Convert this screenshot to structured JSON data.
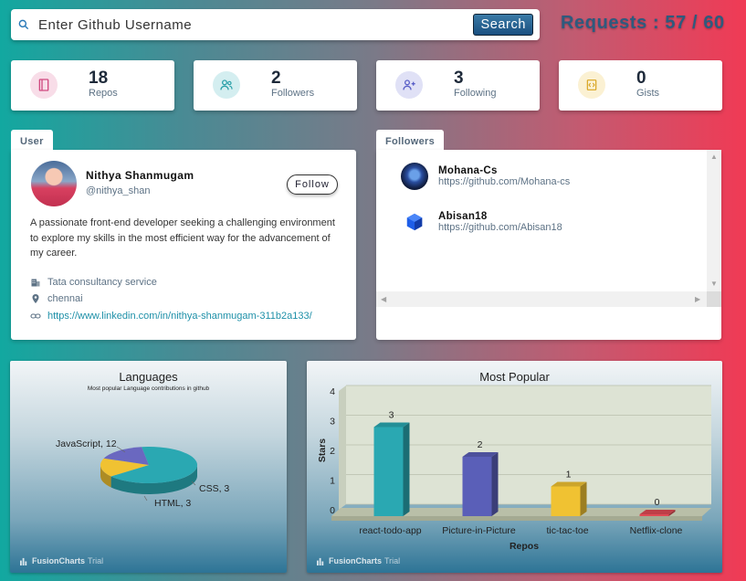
{
  "search": {
    "placeholder": "Enter Github Username",
    "button_label": "Search"
  },
  "requests_text": "Requests : 57 / 60",
  "stats": [
    {
      "value": "18",
      "label": "Repos",
      "icon": "book-icon",
      "color": "#d04a80",
      "bg": "#f8dde8"
    },
    {
      "value": "2",
      "label": "Followers",
      "icon": "users-icon",
      "color": "#2aa0a8",
      "bg": "#d4eef0"
    },
    {
      "value": "3",
      "label": "Following",
      "icon": "user-plus-icon",
      "color": "#5a5fc8",
      "bg": "#e0e1f6"
    },
    {
      "value": "0",
      "label": "Gists",
      "icon": "code-icon",
      "color": "#d8a520",
      "bg": "#fbf1d3"
    }
  ],
  "user": {
    "tab_label": "User",
    "name": "Nithya Shanmugam",
    "handle": "@nithya_shan",
    "follow_label": "Follow",
    "bio": "A passionate front-end developer seeking a challenging environment to explore my skills in the most efficient way for the advancement of my career.",
    "company": "Tata consultancy service",
    "location": "chennai",
    "blog": "https://www.linkedin.com/in/nithya-shanmugam-311b2a133/"
  },
  "followers": {
    "tab_label": "Followers",
    "items": [
      {
        "login": "Mohana-Cs",
        "url": "https://github.com/Mohana-cs"
      },
      {
        "login": "Abisan18",
        "url": "https://github.com/Abisan18"
      }
    ]
  },
  "watermark": {
    "brand": "FusionCharts",
    "tag": "Trial"
  },
  "chart_data": [
    {
      "type": "pie",
      "title": "Languages",
      "subtitle": "Most popular Language contributions in github",
      "slices": [
        {
          "label": "JavaScript",
          "value": 12,
          "color": "#2aa8b2"
        },
        {
          "label": "CSS",
          "value": 3,
          "color": "#f0c232"
        },
        {
          "label": "HTML",
          "value": 3,
          "color": "#6a68c0"
        }
      ],
      "slice_labels": [
        "JavaScript, 12",
        "CSS, 3",
        "HTML, 3"
      ]
    },
    {
      "type": "bar",
      "title": "Most Popular",
      "xlabel": "Repos",
      "ylabel": "Stars",
      "categories": [
        "react-todo-app",
        "Picture-in-Picture",
        "tic-tac-toe",
        "Netflix-clone"
      ],
      "values": [
        3,
        2,
        1,
        0
      ],
      "colors": [
        "#2aa8b2",
        "#5a5fb8",
        "#f0c232",
        "#e04a55"
      ],
      "ylim": [
        0,
        4
      ],
      "yticks": [
        "0",
        "1",
        "2",
        "3",
        "4"
      ],
      "grid": true
    }
  ]
}
